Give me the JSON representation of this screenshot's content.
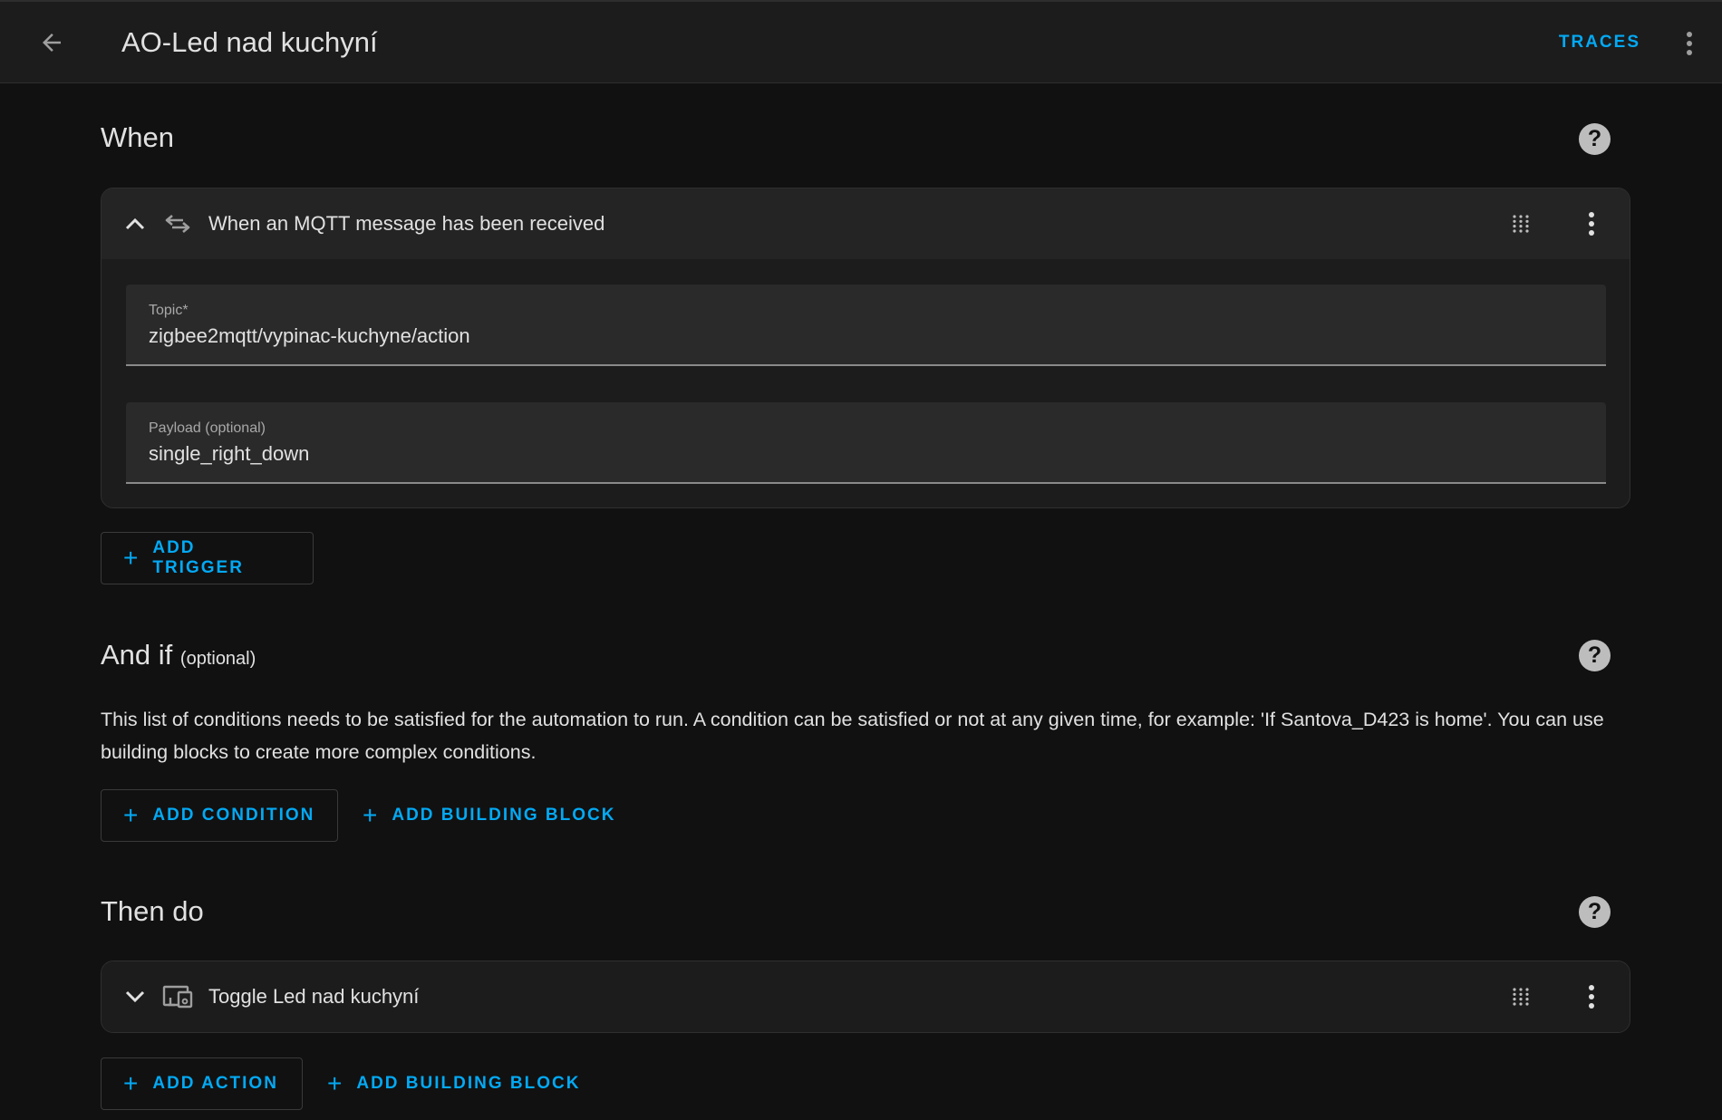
{
  "header": {
    "title": "AO-Led nad kuchyní",
    "traces_label": "TRACES"
  },
  "when": {
    "title": "When",
    "trigger": {
      "title": "When an MQTT message has been received",
      "topic_label": "Topic*",
      "topic_value": "zigbee2mqtt/vypinac-kuchyne/action",
      "payload_label": "Payload (optional)",
      "payload_value": "single_right_down"
    },
    "add_trigger_label": "ADD TRIGGER"
  },
  "and_if": {
    "title": "And if",
    "optional_label": "(optional)",
    "description": "This list of conditions needs to be satisfied for the automation to run. A condition can be satisfied or not at any given time, for example: 'If Santova_D423 is home'. You can use building blocks to create more complex conditions.",
    "add_condition_label": "ADD CONDITION",
    "add_building_block_label": "ADD BUILDING BLOCK"
  },
  "then_do": {
    "title": "Then do",
    "action": {
      "title": "Toggle Led nad kuchyní"
    },
    "add_action_label": "ADD ACTION",
    "add_building_block_label": "ADD BUILDING BLOCK"
  },
  "icons": {
    "plus": "+",
    "help": "?"
  },
  "colors": {
    "accent": "#03a9f4",
    "background": "#111111",
    "card": "#1c1c1c"
  }
}
